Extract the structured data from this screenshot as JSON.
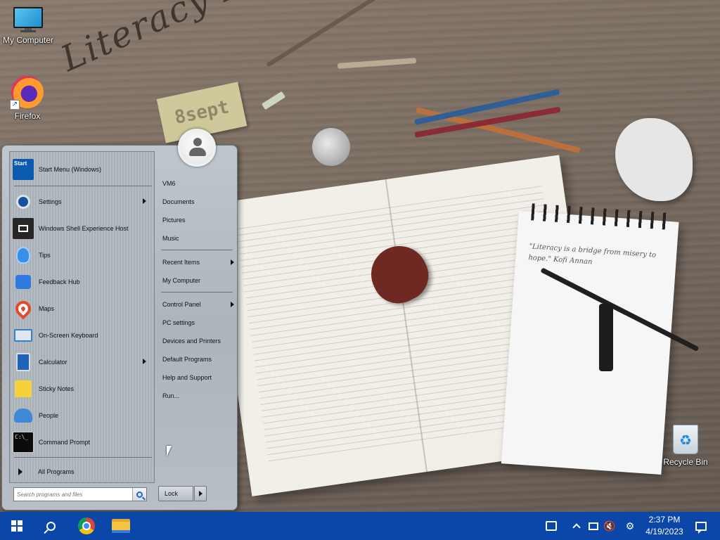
{
  "wallpaper": {
    "title": "Literacy Day",
    "note": "8sept",
    "notebook_text": "\"Literacy is a bridge from misery to hope.\" Kofi Annan"
  },
  "desktop": {
    "icons": [
      {
        "label": "My Computer",
        "icon": "computer-icon"
      },
      {
        "label": "Firefox",
        "icon": "firefox-icon"
      },
      {
        "label": "Recycle Bin",
        "icon": "recycle-bin-icon"
      }
    ]
  },
  "start_menu": {
    "left_items": [
      {
        "label": "Start Menu (Windows)",
        "icon": "start-menu-icon",
        "icon_text": "Start"
      },
      {
        "label": "Settings",
        "icon": "settings-icon",
        "submenu": true
      },
      {
        "label": "Windows Shell Experience Host",
        "icon": "shell-host-icon"
      },
      {
        "label": "Tips",
        "icon": "tips-icon"
      },
      {
        "label": "Feedback Hub",
        "icon": "feedback-hub-icon"
      },
      {
        "label": "Maps",
        "icon": "maps-icon"
      },
      {
        "label": "On-Screen Keyboard",
        "icon": "keyboard-icon"
      },
      {
        "label": "Calculator",
        "icon": "calculator-icon",
        "submenu": true
      },
      {
        "label": "Sticky Notes",
        "icon": "sticky-notes-icon"
      },
      {
        "label": "People",
        "icon": "people-icon"
      },
      {
        "label": "Command Prompt",
        "icon": "command-prompt-icon",
        "icon_text": "C:\\_"
      }
    ],
    "all_programs": "All Programs",
    "search_placeholder": "Search programs and files",
    "right_items": [
      {
        "label": "VM6"
      },
      {
        "label": "Documents"
      },
      {
        "label": "Pictures"
      },
      {
        "label": "Music"
      },
      {
        "label": "Recent Items",
        "submenu": true
      },
      {
        "label": "My Computer"
      },
      {
        "label": "Control Panel",
        "submenu": true
      },
      {
        "label": "PC settings"
      },
      {
        "label": "Devices and Printers"
      },
      {
        "label": "Default Programs"
      },
      {
        "label": "Help and Support"
      },
      {
        "label": "Run..."
      }
    ],
    "lock_label": "Lock"
  },
  "taskbar": {
    "pinned": [
      "start-button",
      "search-button",
      "chrome-icon",
      "file-explorer-icon"
    ],
    "clock": {
      "time": "2:37 PM",
      "date": "4/19/2023"
    }
  }
}
